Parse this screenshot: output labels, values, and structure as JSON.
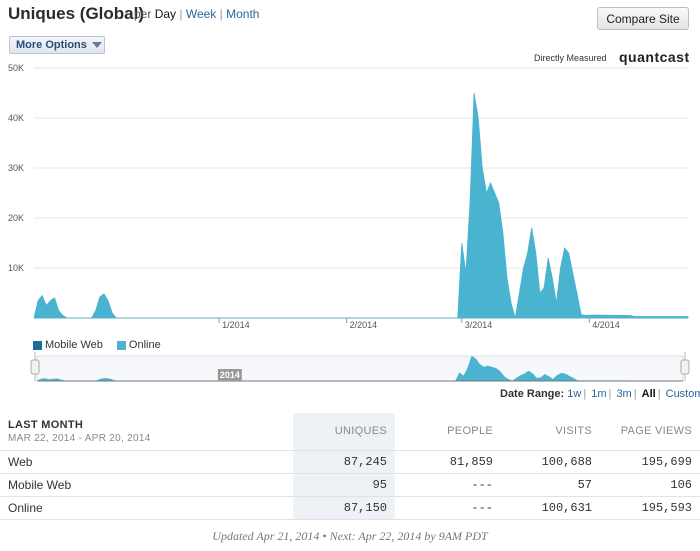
{
  "header": {
    "title": "Uniques (Global)",
    "per": "per",
    "periods": [
      "Day",
      "Week",
      "Month"
    ],
    "compare_button": "Compare Site",
    "more_options": "More Options",
    "measured_label": "Directly Measured",
    "brand": "quantcast"
  },
  "colors": {
    "online": "#4ab3cf",
    "mobile_web": "#1f6b9a"
  },
  "chart_data": {
    "type": "area",
    "title": "",
    "xlabel": "",
    "ylabel": "",
    "ylim": [
      0,
      50000
    ],
    "yticks": [
      "50K",
      "40K",
      "30K",
      "20K",
      "10K"
    ],
    "ytick_values": [
      50000,
      40000,
      30000,
      20000,
      10000
    ],
    "xticks": [
      "1/2014",
      "2/2014",
      "3/2014",
      "4/2014"
    ],
    "xtick_days": [
      45,
      76,
      104,
      135
    ],
    "x_days_range": [
      0,
      159
    ],
    "grid": true,
    "series": [
      {
        "name": "Online",
        "points": [
          [
            0,
            0
          ],
          [
            1,
            3500
          ],
          [
            2,
            4500
          ],
          [
            3,
            2500
          ],
          [
            4,
            3500
          ],
          [
            5,
            4000
          ],
          [
            6,
            1500
          ],
          [
            7,
            500
          ],
          [
            8,
            0
          ],
          [
            14,
            0
          ],
          [
            15,
            1500
          ],
          [
            16,
            4200
          ],
          [
            17,
            4800
          ],
          [
            18,
            3500
          ],
          [
            19,
            1000
          ],
          [
            20,
            0
          ],
          [
            102,
            0
          ],
          [
            103,
            0
          ],
          [
            104,
            15000
          ],
          [
            105,
            9000
          ],
          [
            106,
            23000
          ],
          [
            107,
            45000
          ],
          [
            108,
            40000
          ],
          [
            109,
            30000
          ],
          [
            110,
            25000
          ],
          [
            111,
            27000
          ],
          [
            112,
            25000
          ],
          [
            113,
            23000
          ],
          [
            114,
            17000
          ],
          [
            115,
            8000
          ],
          [
            116,
            3000
          ],
          [
            117,
            0
          ],
          [
            118,
            5000
          ],
          [
            119,
            10000
          ],
          [
            120,
            13000
          ],
          [
            121,
            18000
          ],
          [
            122,
            13000
          ],
          [
            123,
            5000
          ],
          [
            124,
            6000
          ],
          [
            125,
            12000
          ],
          [
            126,
            8000
          ],
          [
            127,
            3000
          ],
          [
            128,
            10000
          ],
          [
            129,
            14000
          ],
          [
            130,
            13000
          ],
          [
            131,
            9000
          ],
          [
            132,
            5000
          ],
          [
            133,
            700
          ],
          [
            134,
            500
          ],
          [
            136,
            600
          ],
          [
            145,
            500
          ],
          [
            146,
            300
          ],
          [
            159,
            300
          ]
        ]
      },
      {
        "name": "Mobile Web",
        "points": []
      }
    ]
  },
  "legend": [
    "Mobile Web",
    "Online"
  ],
  "navigator": {
    "year_label": "2014"
  },
  "date_range": {
    "label": "Date Range:",
    "options": [
      "1w",
      "1m",
      "3m",
      "All",
      "Custom"
    ],
    "active": "All"
  },
  "table": {
    "period_title": "LAST MONTH",
    "period_range": "MAR 22, 2014 - APR 20, 2014",
    "columns": [
      "UNIQUES",
      "PEOPLE",
      "VISITS",
      "PAGE VIEWS"
    ],
    "rows": [
      {
        "label": "Web",
        "cells": [
          "87,245",
          "81,859",
          "100,688",
          "195,699"
        ]
      },
      {
        "label": "Mobile Web",
        "cells": [
          "95",
          "---",
          "57",
          "106"
        ]
      },
      {
        "label": "Online",
        "cells": [
          "87,150",
          "---",
          "100,631",
          "195,593"
        ]
      }
    ]
  },
  "footer": "Updated Apr 21, 2014 • Next: Apr 22, 2014 by 9AM PDT"
}
